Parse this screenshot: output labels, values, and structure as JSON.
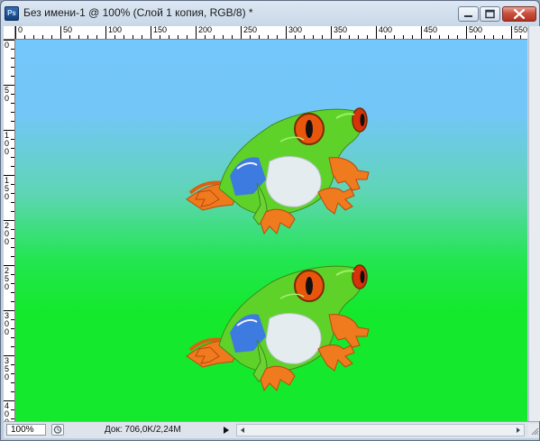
{
  "window": {
    "app_icon_label": "Ps",
    "title": "Без имени-1 @ 100% (Слой 1 копия, RGB/8) *"
  },
  "rulers": {
    "top_labels": [
      "0",
      "50",
      "100",
      "150",
      "200",
      "250",
      "300",
      "350",
      "400",
      "450",
      "500",
      "550"
    ],
    "left_labels": [
      "0",
      "5\n0",
      "1\n0\n0",
      "1\n5\n0",
      "2\n0\n0",
      "2\n5\n0",
      "3\n0\n0",
      "3\n5\n0",
      "4\n0\n0"
    ]
  },
  "status": {
    "zoom": "100%",
    "doc_info": "Док: 706,0K/2,24M"
  },
  "colors": {
    "sky_blue": "#74c7fa",
    "bright_green": "#14e92d",
    "close_red": "#c9503d"
  },
  "icons": [
    "photoshop-app-icon",
    "minimize-icon",
    "maximize-icon",
    "close-icon",
    "status-info-icon",
    "right-arrow-icon",
    "scroll-left-icon",
    "scroll-right-icon",
    "resize-grip-icon"
  ]
}
